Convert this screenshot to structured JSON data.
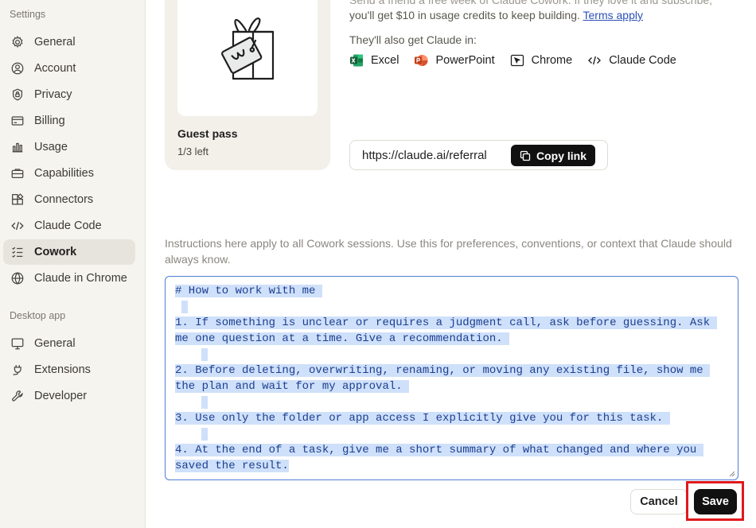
{
  "sidebar": {
    "settings_label": "Settings",
    "settings_items": [
      {
        "label": "General",
        "icon": "gear-icon"
      },
      {
        "label": "Account",
        "icon": "user-circle-icon"
      },
      {
        "label": "Privacy",
        "icon": "shield-lock-icon"
      },
      {
        "label": "Billing",
        "icon": "credit-card-icon"
      },
      {
        "label": "Usage",
        "icon": "bar-chart-icon"
      },
      {
        "label": "Capabilities",
        "icon": "briefcase-icon"
      },
      {
        "label": "Connectors",
        "icon": "connectors-icon"
      },
      {
        "label": "Claude Code",
        "icon": "code-icon"
      },
      {
        "label": "Cowork",
        "icon": "checklist-icon",
        "active": true
      },
      {
        "label": "Claude in Chrome",
        "icon": "globe-icon"
      }
    ],
    "desktop_label": "Desktop app",
    "desktop_items": [
      {
        "label": "General",
        "icon": "monitor-icon"
      },
      {
        "label": "Extensions",
        "icon": "plug-icon"
      },
      {
        "label": "Developer",
        "icon": "wrench-icon"
      }
    ]
  },
  "guest_pass": {
    "title": "Guest pass",
    "remaining": "1/3 left",
    "image_icon": "gift-box-icon"
  },
  "promo": {
    "cut_line": "Send a friend a free week of Claude Cowork. If they love it and subscribe,",
    "line": "you'll get $10 in usage credits to keep building.",
    "terms_link": "Terms apply",
    "also_label": "They'll also get Claude in:",
    "apps": [
      {
        "label": "Excel",
        "icon": "excel-icon"
      },
      {
        "label": "PowerPoint",
        "icon": "powerpoint-icon"
      },
      {
        "label": "Chrome",
        "icon": "chrome-cursor-icon"
      },
      {
        "label": "Claude Code",
        "icon": "code-icon"
      }
    ]
  },
  "referral": {
    "url": "https://claude.ai/referral",
    "copy_label": "Copy link"
  },
  "instructions": {
    "description": "Instructions here apply to all Cowork sessions. Use this for preferences, conventions, or context that Claude should always know.",
    "lines": [
      "# How to work with me ",
      " ",
      "1. If something is unclear or requires a judgment call, ask before guessing. Ask ",
      "me one question at a time. Give a recommendation. ",
      " ",
      "2. Before deleting, overwriting, renaming, or moving any existing file, show me ",
      "the plan and wait for my approval. ",
      " ",
      "3. Use only the folder or app access I explicitly give you for this task. ",
      " ",
      "4. At the end of a task, give me a short summary of what changed and where you ",
      "saved the result."
    ]
  },
  "actions": {
    "cancel_label": "Cancel",
    "save_label": "Save"
  },
  "colors": {
    "sidebar_bg": "#f5f4ef",
    "active_item_bg": "#e6e4dd",
    "selection_bg": "#cfe0fa",
    "textarea_border": "#4f7ed6",
    "highlight_red": "#e0191e",
    "link_blue": "#2b4fb8"
  }
}
